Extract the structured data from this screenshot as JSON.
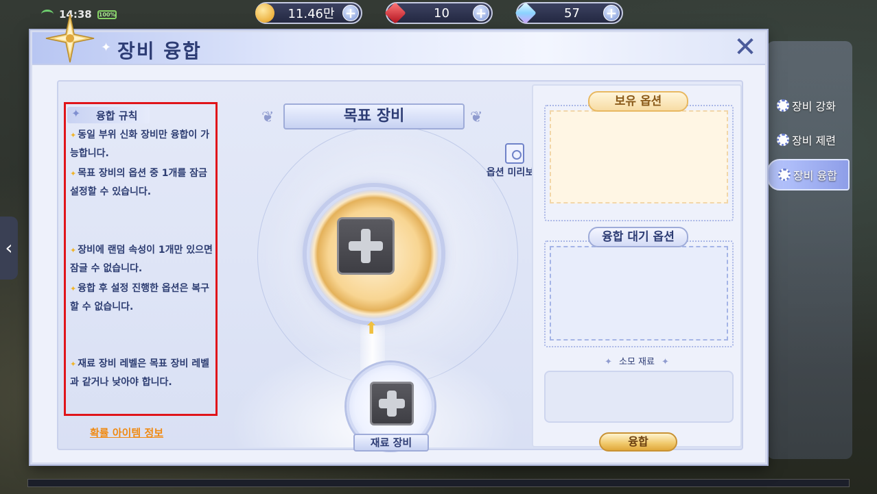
{
  "status": {
    "time": "14:38",
    "battery": "100%"
  },
  "currencies": [
    {
      "icon": "coin-icon",
      "value": "11.46만"
    },
    {
      "icon": "ruby-icon",
      "value": "10"
    },
    {
      "icon": "crystal-icon",
      "value": "57"
    }
  ],
  "dialog": {
    "title": "장비 융합",
    "rules": {
      "title": "융합 규칙",
      "items": [
        "동일 부위 신화 장비만 융합이 가능합니다.",
        "목표 장비의 옵션 중 1개를 잠금 설정할 수 있습니다.",
        "장비에 랜덤 속성이 1개만 있으면 잠글 수 없습니다.",
        "융합 후 설정 진행한 옵션은 복구할 수 없습니다.",
        "재료 장비 레벨은 목표 장비 레벨과 같거나 낮아야 합니다."
      ]
    },
    "probability_link": "확률 아이템 정보",
    "target_banner": "목표 장비",
    "preview_label": "옵션 미리보기",
    "material_label": "재료 장비",
    "owned_options": "보유 옵션",
    "pending_options": "융합 대기 옵션",
    "consume_label": "소모 재료",
    "fuse_button": "융합"
  },
  "side_menu": {
    "items": [
      "장비 강화",
      "장비 제련",
      "장비 융합"
    ],
    "active": "장비 융합"
  },
  "colors": {
    "rules_highlight": "#e0141a",
    "link": "#f08a12",
    "title": "#2d3c74"
  }
}
